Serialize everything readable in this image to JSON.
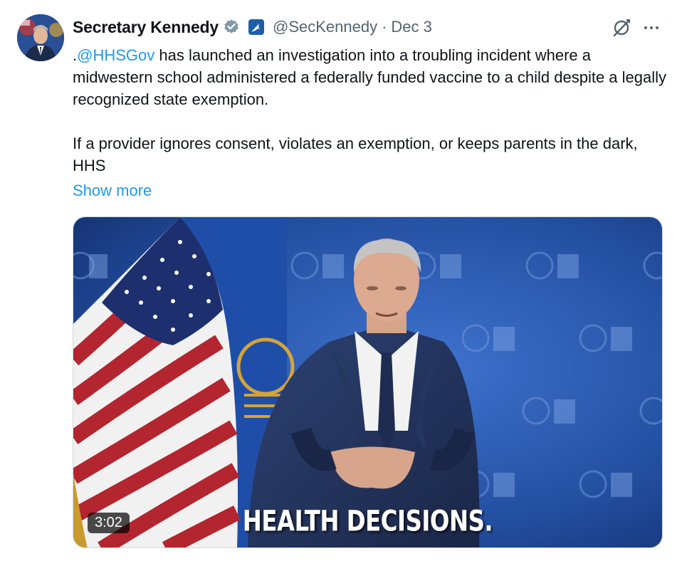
{
  "author": {
    "display_name": "Secretary Kennedy",
    "handle": "@SecKennedy",
    "separator": "·",
    "date": "Dec 3"
  },
  "icons": {
    "verified": "verified-badge-icon",
    "affiliation": "hhs-eagle-icon",
    "grok": "grok-icon",
    "more": "more-icon"
  },
  "tweet": {
    "mention": "@HHSGov",
    "mention_prefix": ".",
    "line1_rest": " has launched an investigation into a troubling incident where a midwestern school administered a federally funded vaccine to a child despite a legally recognized state exemption.",
    "para2": "If a provider ignores consent, violates an exemption, or keeps parents in the dark, HHS",
    "show_more": "Show more"
  },
  "video": {
    "duration": "3:02",
    "caption": "HEALTH DECISIONS."
  },
  "colors": {
    "link": "#1d9bf0",
    "secondary_text": "#536471",
    "verified": "#829aab"
  }
}
